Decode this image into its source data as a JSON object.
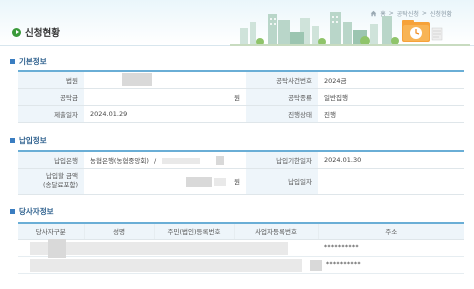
{
  "header": {
    "title": "신청현황",
    "breadcrumb": [
      "홈",
      "공탁신청",
      "신청현황"
    ],
    "separator": ">"
  },
  "basic": {
    "section_title": "기본정보",
    "rows": [
      {
        "l1": "법원",
        "v1": "",
        "l2": "공탁사건번호",
        "v2": "2024금"
      },
      {
        "l1": "공탁금",
        "v1": "원",
        "l2": "공탁종류",
        "v2": "일반집행"
      },
      {
        "l1": "제출일자",
        "v1": "2024.01.29",
        "l2": "진행상태",
        "v2": "진행"
      }
    ]
  },
  "payment": {
    "section_title": "납입정보",
    "bank_label": "납입은행",
    "bank_value": "농협은행(농협중앙회)",
    "bank_slash": "/",
    "due_label": "납입기한일자",
    "due_value": "2024.01.30",
    "amount_label_1": "납입할 금액",
    "amount_label_2": "(송달료포함)",
    "amount_unit": "원",
    "paid_label": "납입일자",
    "paid_value": ""
  },
  "parties": {
    "section_title": "당사자정보",
    "columns": [
      "당사자구분",
      "성명",
      "주민(법인)등록번호",
      "사업자등록번호",
      "주소"
    ],
    "rows": [
      {
        "masked": "**********"
      },
      {
        "masked": "**********"
      }
    ]
  },
  "colors": {
    "accent": "#6aaed6",
    "section_title": "#2b5e8c",
    "title_bullet": "#3a9a3a",
    "label_bg": "#eef5fa"
  }
}
